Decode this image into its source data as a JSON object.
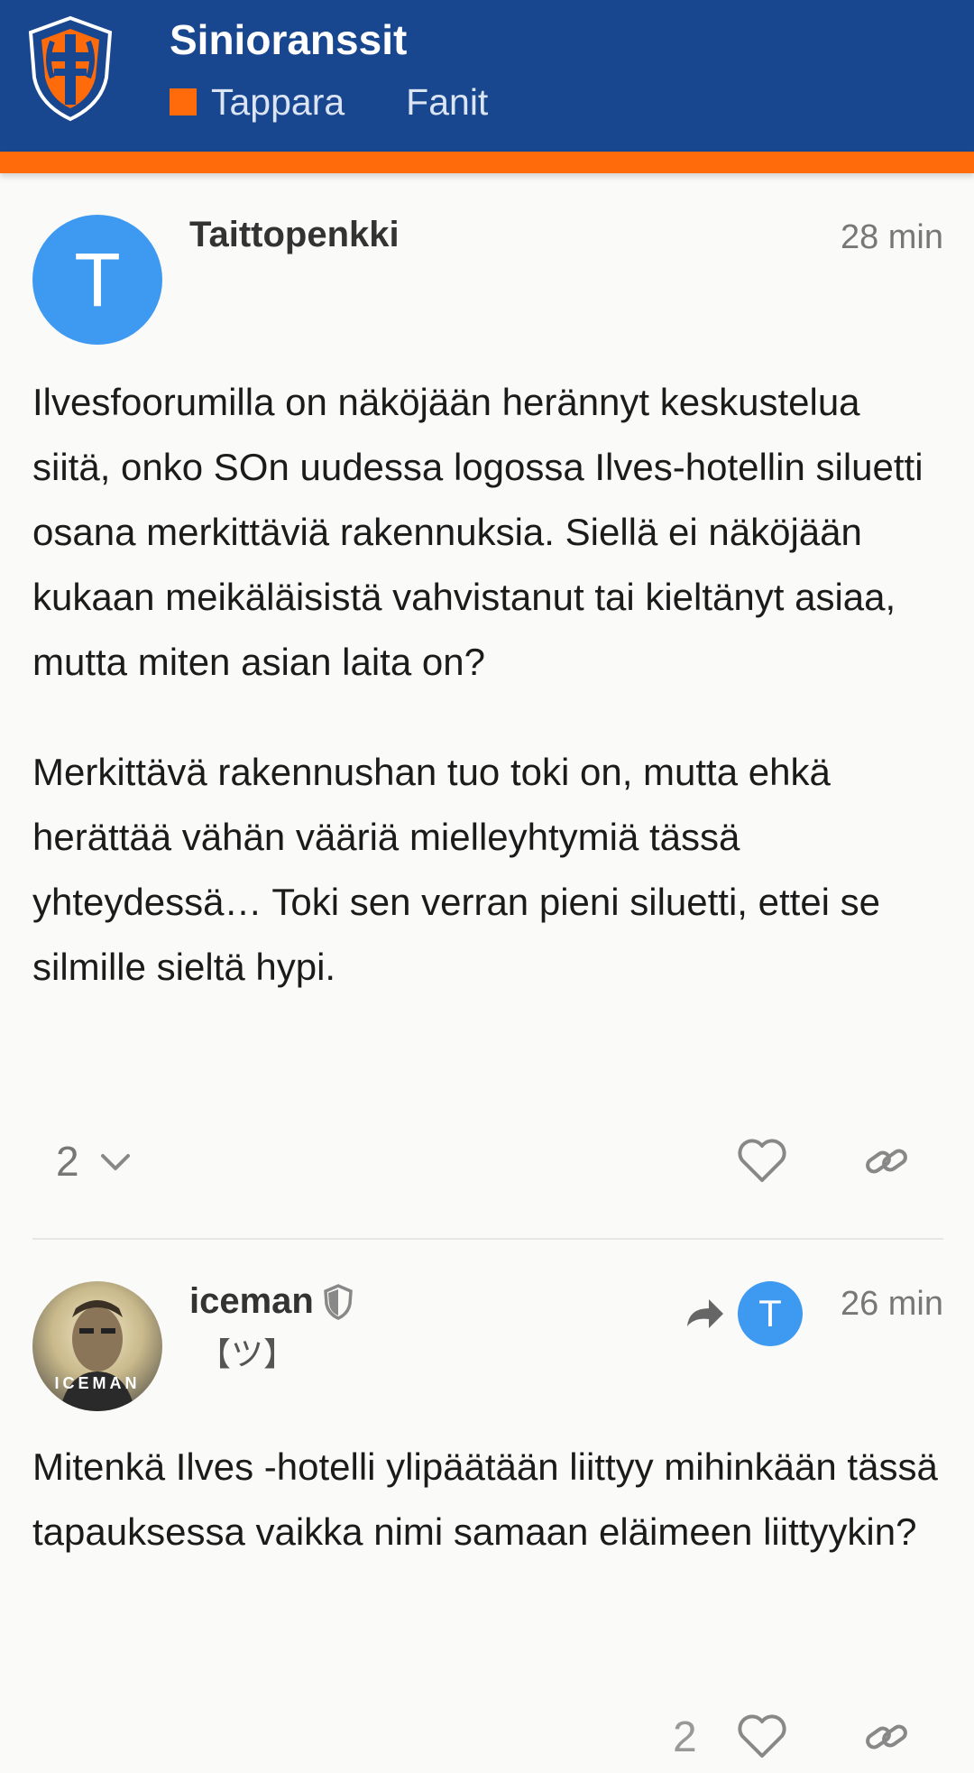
{
  "header": {
    "site_title": "Sinioranssit",
    "category": "Tappara",
    "subcategory": "Fanit",
    "logo_icon": "tappara-shield-logo",
    "brand_color": "#18468f",
    "accent_color": "#ff6a0a"
  },
  "posts": [
    {
      "avatar_letter": "T",
      "username": "Taittopenkki",
      "time": "28 min",
      "paragraphs": [
        "Ilvesfoorumilla on näköjään herännyt keskustelua siitä, onko SOn uudessa logossa Ilves-hotellin siluetti osana merkittäviä rakennuksia. Siellä ei näköjään kukaan meikäläisistä vahvistanut tai kieltänyt asiaa, mutta miten asian laita on?",
        "Merkittävä rakennushan tuo toki on, mutta ehkä herättää vähän vääriä mielleyhtymiä tässä yhteydessä… Toki sen verran pieni siluetti, ettei se silmille sieltä hypi."
      ],
      "like_count": "2"
    },
    {
      "avatar_label": "ICEMAN",
      "username": "iceman",
      "user_title": "【ツ】",
      "reply_to_letter": "T",
      "time": "26 min",
      "paragraphs": [
        "Mitenkä Ilves -hotelli ylipäätään liittyy mihinkään tässä tapauksessa vaikka nimi samaan eläimeen liittyykin?"
      ],
      "like_count": "2"
    }
  ]
}
